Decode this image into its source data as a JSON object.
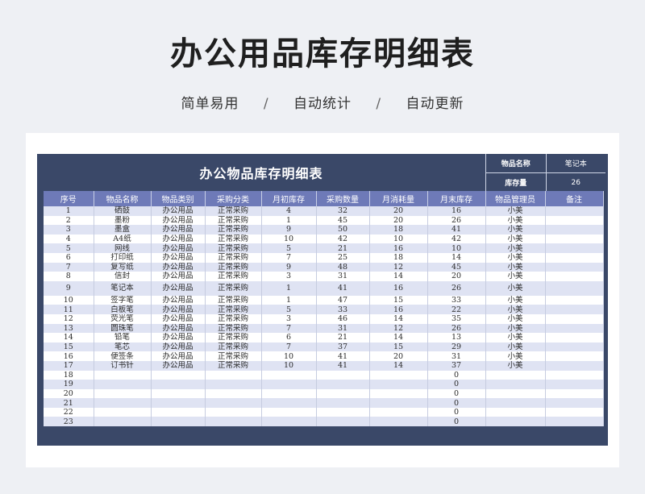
{
  "hero": {
    "title": "办公用品库存明细表",
    "tags": [
      "简单易用",
      "自动统计",
      "自动更新"
    ],
    "separator": "/"
  },
  "sheet": {
    "title": "办公物品库存明细表",
    "info": [
      {
        "label": "物品名称",
        "value": "笔记本"
      },
      {
        "label": "库存量",
        "value": "26"
      }
    ],
    "columns": [
      "序号",
      "物品名称",
      "物品类别",
      "采购分类",
      "月初库存",
      "采购数量",
      "月消耗量",
      "月末库存",
      "物品管理员",
      "备注"
    ],
    "rows": [
      [
        "1",
        "硒鼓",
        "办公用品",
        "正常采购",
        "4",
        "32",
        "20",
        "16",
        "小美",
        ""
      ],
      [
        "2",
        "墨粉",
        "办公用品",
        "正常采购",
        "1",
        "45",
        "20",
        "26",
        "小美",
        ""
      ],
      [
        "3",
        "墨盒",
        "办公用品",
        "正常采购",
        "9",
        "50",
        "18",
        "41",
        "小美",
        ""
      ],
      [
        "4",
        "A4纸",
        "办公用品",
        "正常采购",
        "10",
        "42",
        "10",
        "42",
        "小美",
        ""
      ],
      [
        "5",
        "网线",
        "办公用品",
        "正常采购",
        "5",
        "21",
        "16",
        "10",
        "小美",
        ""
      ],
      [
        "6",
        "打印纸",
        "办公用品",
        "正常采购",
        "7",
        "25",
        "18",
        "14",
        "小美",
        ""
      ],
      [
        "7",
        "复写纸",
        "办公用品",
        "正常采购",
        "9",
        "48",
        "12",
        "45",
        "小美",
        ""
      ],
      [
        "8",
        "信封",
        "办公用品",
        "正常采购",
        "3",
        "31",
        "14",
        "20",
        "小美",
        ""
      ],
      [
        "9",
        "笔记本",
        "办公用品",
        "正常采购",
        "1",
        "41",
        "16",
        "26",
        "小美",
        ""
      ],
      [
        "10",
        "签字笔",
        "办公用品",
        "正常采购",
        "1",
        "47",
        "15",
        "33",
        "小美",
        ""
      ],
      [
        "11",
        "白板笔",
        "办公用品",
        "正常采购",
        "5",
        "33",
        "16",
        "22",
        "小美",
        ""
      ],
      [
        "12",
        "荧光笔",
        "办公用品",
        "正常采购",
        "3",
        "46",
        "14",
        "35",
        "小美",
        ""
      ],
      [
        "13",
        "圆珠笔",
        "办公用品",
        "正常采购",
        "7",
        "31",
        "12",
        "26",
        "小美",
        ""
      ],
      [
        "14",
        "铅笔",
        "办公用品",
        "正常采购",
        "6",
        "21",
        "14",
        "13",
        "小美",
        ""
      ],
      [
        "15",
        "笔芯",
        "办公用品",
        "正常采购",
        "7",
        "37",
        "15",
        "29",
        "小美",
        ""
      ],
      [
        "16",
        "便签条",
        "办公用品",
        "正常采购",
        "10",
        "41",
        "20",
        "31",
        "小美",
        ""
      ],
      [
        "17",
        "订书针",
        "办公用品",
        "正常采购",
        "10",
        "41",
        "14",
        "37",
        "小美",
        ""
      ],
      [
        "18",
        "",
        "",
        "",
        "",
        "",
        "",
        "0",
        "",
        ""
      ],
      [
        "19",
        "",
        "",
        "",
        "",
        "",
        "",
        "0",
        "",
        ""
      ],
      [
        "20",
        "",
        "",
        "",
        "",
        "",
        "",
        "0",
        "",
        ""
      ],
      [
        "21",
        "",
        "",
        "",
        "",
        "",
        "",
        "0",
        "",
        ""
      ],
      [
        "22",
        "",
        "",
        "",
        "",
        "",
        "",
        "0",
        "",
        ""
      ],
      [
        "23",
        "",
        "",
        "",
        "",
        "",
        "",
        "0",
        "",
        ""
      ]
    ]
  },
  "colors": {
    "sheet_bg": "#3a4868",
    "header_bg": "#6e7ab8",
    "stripe": "#dfe3f3"
  }
}
